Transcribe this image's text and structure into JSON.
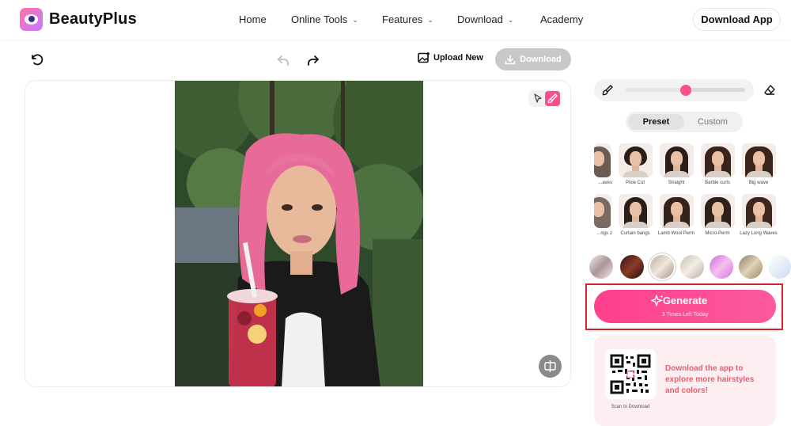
{
  "header": {
    "brand": "BeautyPlus",
    "nav": [
      {
        "label": "Home",
        "has_menu": false
      },
      {
        "label": "Online Tools",
        "has_menu": true
      },
      {
        "label": "Features",
        "has_menu": true
      },
      {
        "label": "Download",
        "has_menu": true
      },
      {
        "label": "Academy",
        "has_menu": false
      }
    ],
    "cta": "Download App"
  },
  "toolbar": {
    "undo_icon": "rotate-left-icon",
    "back_icon": "arrow-back-icon",
    "forward_icon": "arrow-forward-icon",
    "upload_label": "Upload New",
    "download_label": "Download"
  },
  "panel": {
    "brush_size": 0.5,
    "tabs": {
      "preset": "Preset",
      "custom": "Custom"
    },
    "styles_row1": [
      "...aves",
      "Pixie Cut",
      "Straight",
      "Barbie curls",
      "Big wave"
    ],
    "styles_row2": [
      "...ngs 2",
      "Curtain bangs",
      "Lamb Wool Perm",
      "Micro-Perm",
      "Lazy Long Waves"
    ],
    "swatches": [
      "#b9a7a5",
      "#6b2a1e",
      "#c7b5a4",
      "#d9cfc4",
      "#e58fd6",
      "#b3a083",
      "#dfe7f2"
    ],
    "generate": {
      "label": "Generate",
      "sub": "3 Times Left Today"
    },
    "promo": {
      "text": "Download the app to explore more hairstyles and colors!",
      "scan": "Scan to Download"
    }
  },
  "colors": {
    "accent": "#fa4f8f",
    "promo_text": "#f05a6e",
    "highlight": "#d3232a"
  }
}
